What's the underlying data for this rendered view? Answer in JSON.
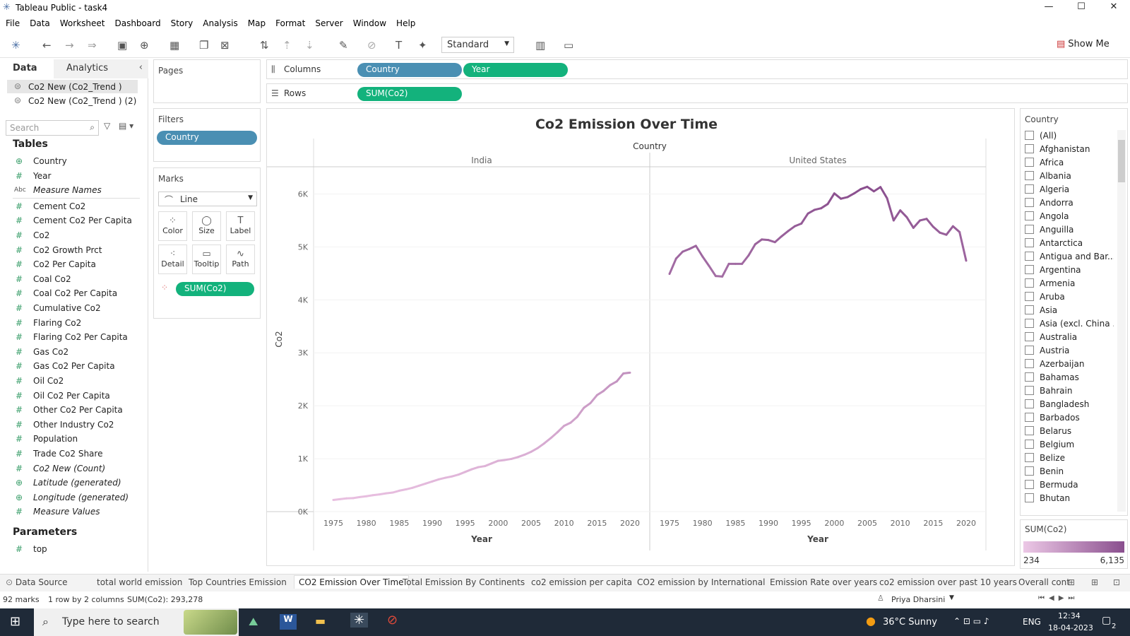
{
  "window": {
    "title": "Tableau Public - task4",
    "minimize": "—",
    "maximize": "☐",
    "close": "✕"
  },
  "menu": [
    "File",
    "Data",
    "Worksheet",
    "Dashboard",
    "Story",
    "Analysis",
    "Map",
    "Format",
    "Server",
    "Window",
    "Help"
  ],
  "toolbar": {
    "fit_value": "Standard",
    "show_me": "Show Me"
  },
  "left": {
    "tab_data": "Data",
    "tab_analytics": "Analytics",
    "sources": [
      "Co2 New (Co2_Trend )",
      "Co2 New (Co2_Trend ) (2)"
    ],
    "search_placeholder": "Search",
    "tables_header": "Tables",
    "fields": [
      {
        "icon": "globe",
        "name": "Country",
        "italic": false
      },
      {
        "icon": "#",
        "name": "Year",
        "italic": false
      },
      {
        "icon": "Abc",
        "name": "Measure Names",
        "italic": true
      },
      {
        "icon": "#",
        "name": "Cement Co2",
        "italic": false
      },
      {
        "icon": "#",
        "name": "Cement Co2 Per Capita",
        "italic": false
      },
      {
        "icon": "#",
        "name": "Co2",
        "italic": false
      },
      {
        "icon": "#",
        "name": "Co2 Growth Prct",
        "italic": false
      },
      {
        "icon": "#",
        "name": "Co2 Per Capita",
        "italic": false
      },
      {
        "icon": "#",
        "name": "Coal Co2",
        "italic": false
      },
      {
        "icon": "#",
        "name": "Coal Co2 Per Capita",
        "italic": false
      },
      {
        "icon": "#",
        "name": "Cumulative Co2",
        "italic": false
      },
      {
        "icon": "#",
        "name": "Flaring Co2",
        "italic": false
      },
      {
        "icon": "#",
        "name": "Flaring Co2 Per Capita",
        "italic": false
      },
      {
        "icon": "#",
        "name": "Gas Co2",
        "italic": false
      },
      {
        "icon": "#",
        "name": "Gas Co2 Per Capita",
        "italic": false
      },
      {
        "icon": "#",
        "name": "Oil Co2",
        "italic": false
      },
      {
        "icon": "#",
        "name": "Oil Co2 Per Capita",
        "italic": false
      },
      {
        "icon": "#",
        "name": "Other Co2 Per Capita",
        "italic": false
      },
      {
        "icon": "#",
        "name": "Other Industry Co2",
        "italic": false
      },
      {
        "icon": "#",
        "name": "Population",
        "italic": false
      },
      {
        "icon": "#",
        "name": "Trade Co2 Share",
        "italic": false
      },
      {
        "icon": "#",
        "name": "Co2 New (Count)",
        "italic": true
      },
      {
        "icon": "globe",
        "name": "Latitude (generated)",
        "italic": true
      },
      {
        "icon": "globe",
        "name": "Longitude (generated)",
        "italic": true
      },
      {
        "icon": "#",
        "name": "Measure Values",
        "italic": true
      }
    ],
    "parameters_header": "Parameters",
    "parameters": [
      {
        "icon": "#",
        "name": "top"
      }
    ]
  },
  "shelves": {
    "pages": "Pages",
    "filters": "Filters",
    "filter_pill": "Country",
    "marks": "Marks",
    "mark_type": "Line",
    "mark_buttons": [
      "Color",
      "Size",
      "Label",
      "Detail",
      "Tooltip",
      "Path"
    ],
    "mark_pill": "SUM(Co2)",
    "columns_label": "Columns",
    "columns_pills": [
      "Country",
      "Year"
    ],
    "rows_label": "Rows",
    "rows_pills": [
      "SUM(Co2)"
    ]
  },
  "chart_data": {
    "type": "line",
    "title": "Co2 Emission Over Time",
    "column_header": "Country",
    "panes": [
      "India",
      "United States"
    ],
    "xlabel": "Year",
    "ylabel": "Co2",
    "ylim": [
      0,
      6500
    ],
    "yticks": [
      {
        "v": 0,
        "label": "0K"
      },
      {
        "v": 1000,
        "label": "1K"
      },
      {
        "v": 2000,
        "label": "2K"
      },
      {
        "v": 3000,
        "label": "3K"
      },
      {
        "v": 4000,
        "label": "4K"
      },
      {
        "v": 5000,
        "label": "5K"
      },
      {
        "v": 6000,
        "label": "6K"
      }
    ],
    "xticks": [
      1975,
      1980,
      1985,
      1990,
      1995,
      2000,
      2005,
      2010,
      2015,
      2020
    ],
    "xlim": [
      1972,
      2023
    ],
    "colors": {
      "low": "#e8bfe0",
      "high": "#8a4f8e"
    },
    "series": [
      {
        "name": "India",
        "x": [
          1975,
          1976,
          1977,
          1978,
          1979,
          1980,
          1981,
          1982,
          1983,
          1984,
          1985,
          1986,
          1987,
          1988,
          1989,
          1990,
          1991,
          1992,
          1993,
          1994,
          1995,
          1996,
          1997,
          1998,
          1999,
          2000,
          2001,
          2002,
          2003,
          2004,
          2005,
          2006,
          2007,
          2008,
          2009,
          2010,
          2011,
          2012,
          2013,
          2014,
          2015,
          2016,
          2017,
          2018,
          2019,
          2020
        ],
        "values": [
          220,
          235,
          250,
          255,
          275,
          290,
          310,
          325,
          345,
          360,
          395,
          420,
          450,
          490,
          530,
          570,
          610,
          640,
          665,
          700,
          750,
          800,
          840,
          860,
          910,
          960,
          975,
          995,
          1030,
          1075,
          1130,
          1200,
          1290,
          1390,
          1500,
          1620,
          1680,
          1790,
          1960,
          2050,
          2200,
          2280,
          2390,
          2460,
          2610,
          2625
        ]
      },
      {
        "name": "United States",
        "x": [
          1975,
          1976,
          1977,
          1978,
          1979,
          1980,
          1981,
          1982,
          1983,
          1984,
          1985,
          1986,
          1987,
          1988,
          1989,
          1990,
          1991,
          1992,
          1993,
          1994,
          1995,
          1996,
          1997,
          1998,
          1999,
          2000,
          2001,
          2002,
          2003,
          2004,
          2005,
          2006,
          2007,
          2008,
          2009,
          2010,
          2011,
          2012,
          2013,
          2014,
          2015,
          2016,
          2017,
          2018,
          2019,
          2020
        ],
        "values": [
          4490,
          4780,
          4910,
          4960,
          5020,
          4820,
          4640,
          4450,
          4440,
          4680,
          4680,
          4680,
          4840,
          5050,
          5140,
          5130,
          5090,
          5200,
          5300,
          5390,
          5440,
          5630,
          5700,
          5730,
          5810,
          6010,
          5910,
          5940,
          6010,
          6090,
          6135,
          6050,
          6130,
          5920,
          5500,
          5690,
          5560,
          5360,
          5500,
          5530,
          5380,
          5270,
          5230,
          5390,
          5280,
          4740
        ]
      }
    ]
  },
  "filter_card": {
    "title": "Country",
    "items": [
      "(All)",
      "Afghanistan",
      "Africa",
      "Albania",
      "Algeria",
      "Andorra",
      "Angola",
      "Anguilla",
      "Antarctica",
      "Antigua and Bar...",
      "Argentina",
      "Armenia",
      "Aruba",
      "Asia",
      "Asia (excl. China ...",
      "Australia",
      "Austria",
      "Azerbaijan",
      "Bahamas",
      "Bahrain",
      "Bangladesh",
      "Barbados",
      "Belarus",
      "Belgium",
      "Belize",
      "Benin",
      "Bermuda",
      "Bhutan"
    ]
  },
  "color_legend": {
    "title": "SUM(Co2)",
    "min": "234",
    "max": "6,135"
  },
  "sheet_tabs": {
    "data_source": "Data Source",
    "tabs": [
      "total world emission",
      "Top Countries Emission",
      "CO2 Emission Over Time",
      "Total Emission By Continents",
      "co2 emission per capita",
      "CO2 emission by International",
      "Emission Rate over years",
      "co2 emission over past 10 years",
      "Overall cont"
    ],
    "active": 2
  },
  "status": {
    "marks": "92 marks",
    "dims": "1 row by 2 columns",
    "sum": "SUM(Co2): 293,278",
    "user": "Priya Dharsini"
  },
  "taskbar": {
    "search_placeholder": "Type here to search",
    "weather": "36°C  Sunny",
    "lang": "ENG",
    "time": "12:34",
    "date": "18-04-2023",
    "notif": "2"
  }
}
